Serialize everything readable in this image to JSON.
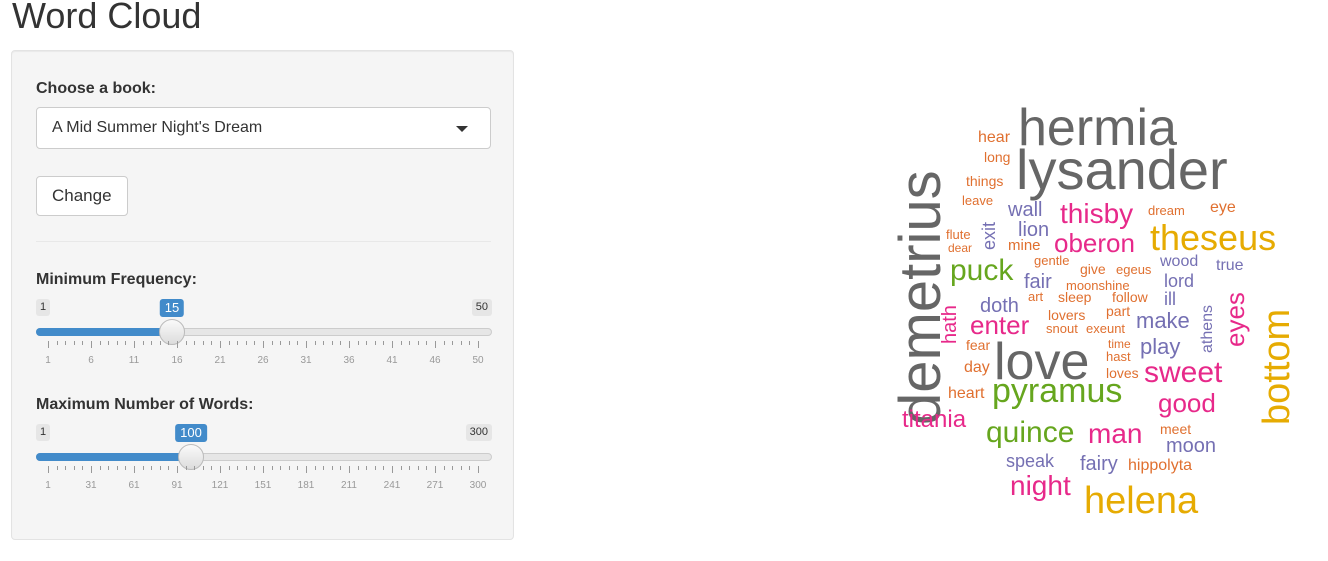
{
  "page": {
    "title": "Word Cloud"
  },
  "sidebar": {
    "book_label": "Choose a book:",
    "book_selected": "A Mid Summer Night's Dream",
    "change_button": "Change",
    "min_freq": {
      "label": "Minimum Frequency:",
      "min": "1",
      "max": "50",
      "value": "15",
      "ticks": [
        "1",
        "6",
        "11",
        "16",
        "21",
        "26",
        "31",
        "36",
        "41",
        "46",
        "50"
      ]
    },
    "max_words": {
      "label": "Maximum Number of Words:",
      "min": "1",
      "max": "300",
      "value": "100",
      "ticks": [
        "1",
        "31",
        "61",
        "91",
        "121",
        "151",
        "181",
        "211",
        "241",
        "271",
        "300"
      ]
    }
  },
  "colors": {
    "accent": "#428bca",
    "gray": "#666666",
    "orange": "#e07030",
    "purple": "#7570b3",
    "pink": "#e7298a",
    "green": "#66a61e",
    "gold": "#e6ab02"
  },
  "word_cloud": [
    "hermia",
    "lysander",
    "demetrius",
    "love",
    "theseus",
    "helena",
    "bottom",
    "pyramus",
    "quince",
    "thisby",
    "oberon",
    "puck",
    "sweet",
    "man",
    "night",
    "good",
    "eyes",
    "enter",
    "titania",
    "make",
    "play",
    "moon",
    "wall",
    "lion",
    "fair",
    "doth",
    "hath",
    "exit",
    "fairy",
    "speak",
    "hippolyta",
    "lord",
    "wood",
    "true",
    "athens",
    "ill",
    "eye",
    "dream",
    "hear",
    "long",
    "things",
    "leave",
    "flute",
    "dear",
    "mine",
    "gentle",
    "give",
    "egeus",
    "moonshine",
    "art",
    "sleep",
    "follow",
    "lovers",
    "part",
    "snout",
    "exeunt",
    "time",
    "hast",
    "loves",
    "fear",
    "day",
    "heart",
    "meet"
  ]
}
